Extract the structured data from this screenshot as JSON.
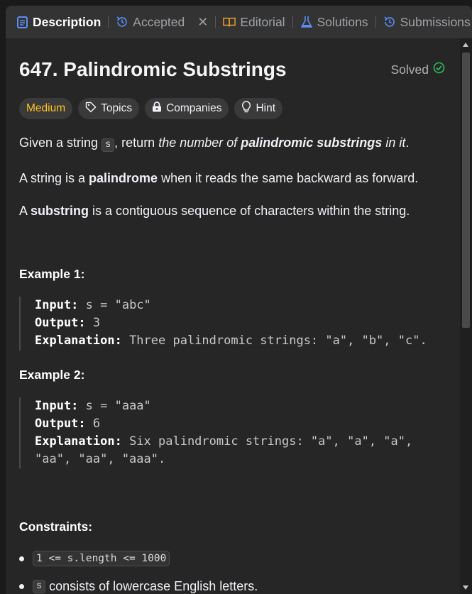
{
  "tabs": [
    {
      "label": "Description",
      "icon": "description-icon",
      "active": true
    },
    {
      "label": "Accepted",
      "icon": "history-icon",
      "active": false
    },
    {
      "label": "Editorial",
      "icon": "book-icon",
      "active": false
    },
    {
      "label": "Solutions",
      "icon": "flask-icon",
      "active": false
    },
    {
      "label": "Submissions",
      "icon": "history-icon",
      "active": false
    }
  ],
  "problem": {
    "title": "647. Palindromic Substrings",
    "status": "Solved",
    "difficulty": "Medium",
    "tags": [
      "Topics",
      "Companies",
      "Hint"
    ]
  },
  "description": {
    "p1_a": "Given a string ",
    "p1_code": "s",
    "p1_b": ", return ",
    "p1_i1": "the number of ",
    "p1_bi": "palindromic substrings",
    "p1_i2": " in it",
    "p1_end": ".",
    "p2_a": "A string is a ",
    "p2_b": "palindrome",
    "p2_c": " when it reads the same backward as forward.",
    "p3_a": "A ",
    "p3_b": "substring",
    "p3_c": " is a contiguous sequence of characters within the string."
  },
  "examples": [
    {
      "title": "Example 1:",
      "input_label": "Input:",
      "input": " s = \"abc\"",
      "output_label": "Output:",
      "output": " 3",
      "expl_label": "Explanation:",
      "expl": " Three palindromic strings: \"a\", \"b\", \"c\".",
      "expl2": ""
    },
    {
      "title": "Example 2:",
      "input_label": "Input:",
      "input": " s = \"aaa\"",
      "output_label": "Output:",
      "output": " 6",
      "expl_label": "Explanation:",
      "expl": " Six palindromic strings: \"a\", \"a\", \"a\",",
      "expl2": "\"aa\", \"aa\", \"aaa\"."
    }
  ],
  "constraints": {
    "title": "Constraints:",
    "items": [
      {
        "code": "1 <= s.length <= 1000",
        "text": ""
      },
      {
        "code": "s",
        "text": " consists of lowercase English letters."
      }
    ]
  },
  "colors": {
    "accent_medium": "#ffc01e",
    "solved_check": "#2cbb5d",
    "tab_icon_blue": "#5b8ef5"
  }
}
